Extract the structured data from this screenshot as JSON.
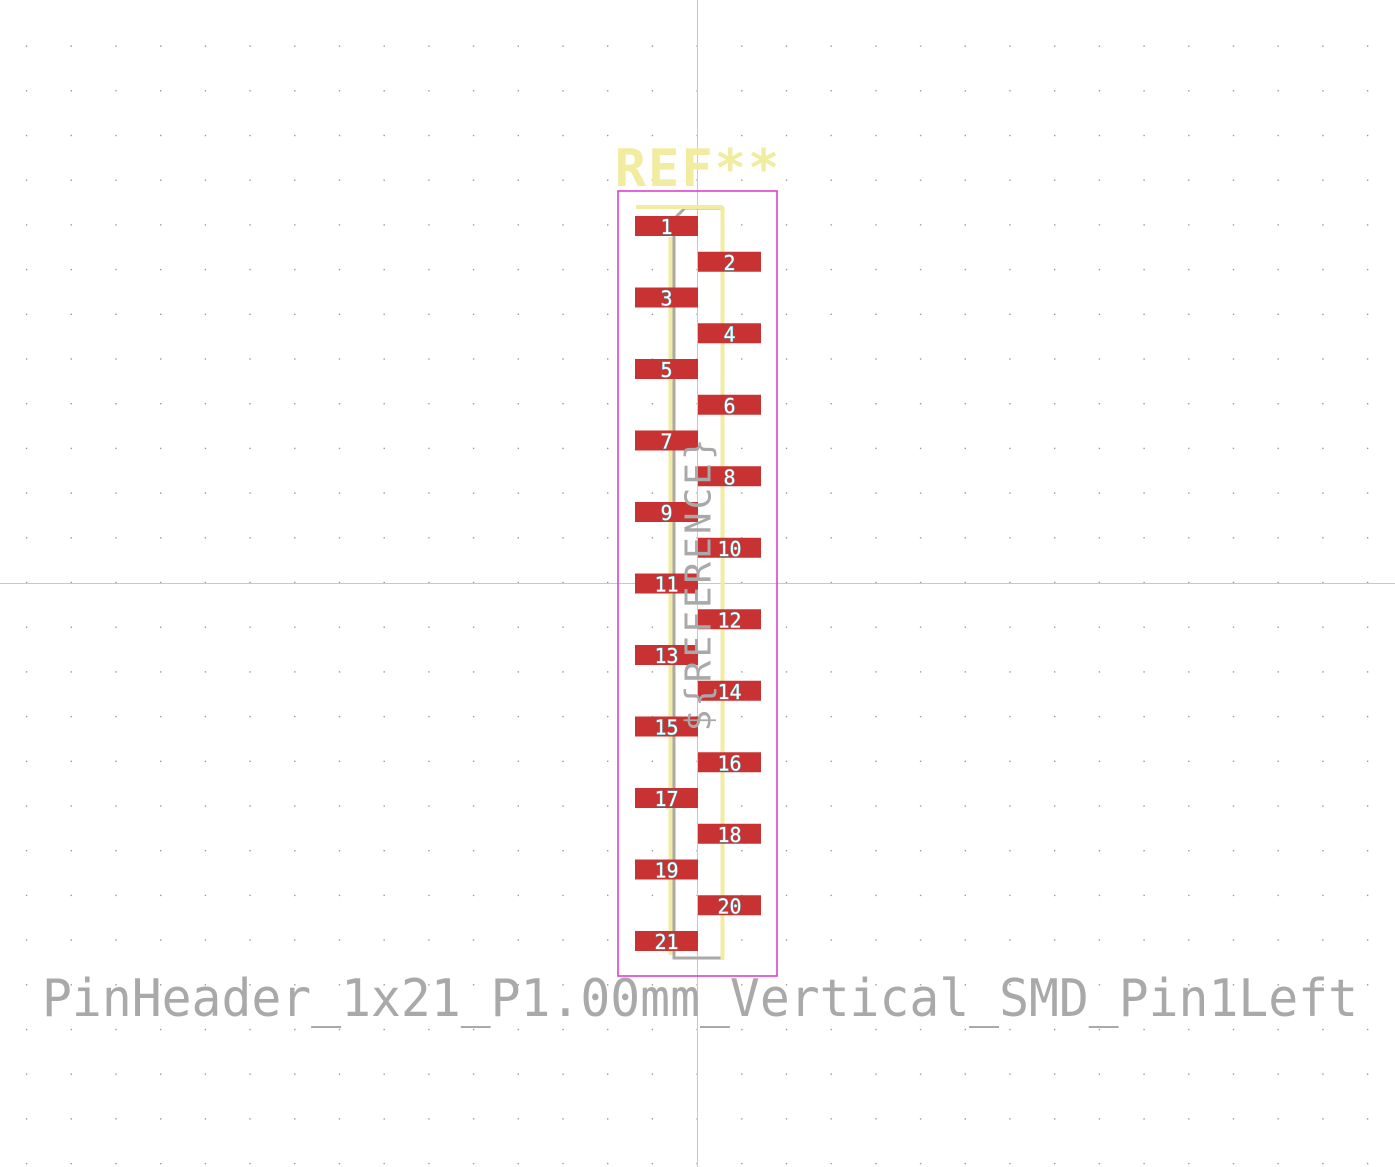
{
  "footprint": {
    "reference": "REF**",
    "value": "PinHeader_1x21_P1.00mm_Vertical_SMD_Pin1Left",
    "fab_reference": "${REFERENCE}"
  },
  "pads": [
    {
      "number": "1",
      "side": "left"
    },
    {
      "number": "2",
      "side": "right"
    },
    {
      "number": "3",
      "side": "left"
    },
    {
      "number": "4",
      "side": "right"
    },
    {
      "number": "5",
      "side": "left"
    },
    {
      "number": "6",
      "side": "right"
    },
    {
      "number": "7",
      "side": "left"
    },
    {
      "number": "8",
      "side": "right"
    },
    {
      "number": "9",
      "side": "left"
    },
    {
      "number": "10",
      "side": "right"
    },
    {
      "number": "11",
      "side": "left"
    },
    {
      "number": "12",
      "side": "right"
    },
    {
      "number": "13",
      "side": "left"
    },
    {
      "number": "14",
      "side": "right"
    },
    {
      "number": "15",
      "side": "left"
    },
    {
      "number": "16",
      "side": "right"
    },
    {
      "number": "17",
      "side": "left"
    },
    {
      "number": "18",
      "side": "right"
    },
    {
      "number": "19",
      "side": "left"
    },
    {
      "number": "20",
      "side": "right"
    },
    {
      "number": "21",
      "side": "left"
    }
  ],
  "colors": {
    "background": "#ffffff",
    "grid_dot": "#9a9a9a",
    "axis": "#c8c8c8",
    "pad": "#c83232",
    "pad_outline": "#4fb0b8",
    "pad_number": "#ffffff",
    "silkscreen": "#f2eca0",
    "courtyard": "#e040d0",
    "fab": "#a9a9a9"
  }
}
